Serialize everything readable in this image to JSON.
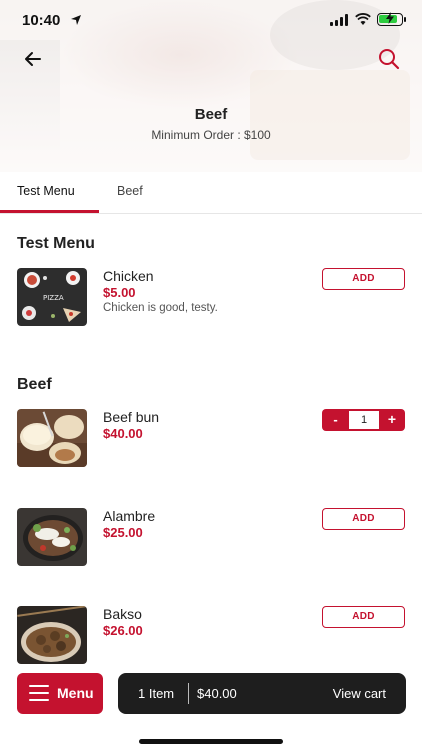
{
  "status_bar": {
    "time": "10:40"
  },
  "header": {
    "store_name": "Beef",
    "min_order": "Minimum Order : $100",
    "back_icon": "arrow-left-icon",
    "search_icon": "search-icon"
  },
  "tabs": [
    {
      "label": "Test Menu",
      "active": true
    },
    {
      "label": "Beef",
      "active": false
    }
  ],
  "sections": [
    {
      "title": "Test Menu",
      "items": [
        {
          "name": "Chicken",
          "price": "$5.00",
          "description": "Chicken is good, testy.",
          "action": "ADD"
        }
      ]
    },
    {
      "title": "Beef",
      "items": [
        {
          "name": "Beef bun",
          "price": "$40.00",
          "quantity": "1",
          "minus": "-",
          "plus": "+"
        },
        {
          "name": "Alambre",
          "price": "$25.00",
          "action": "ADD"
        },
        {
          "name": "Bakso",
          "price": "$26.00",
          "action": "ADD"
        }
      ]
    }
  ],
  "bottom_bar": {
    "menu_label": "Menu",
    "cart_count": "1 Item",
    "cart_total": "$40.00",
    "view_cart": "View cart"
  },
  "colors": {
    "accent": "#c4122f",
    "cart_bar": "#1e1e1e",
    "battery": "#2ecc40"
  }
}
